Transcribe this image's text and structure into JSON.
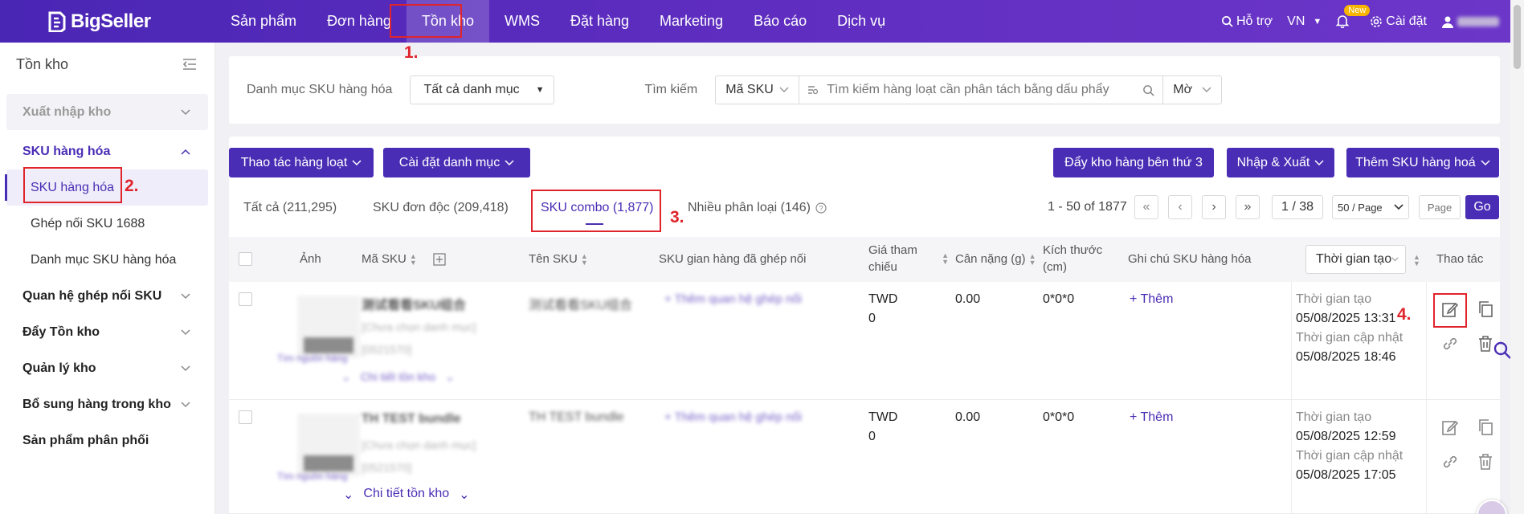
{
  "topnav": {
    "brand": "BigSeller",
    "menu": [
      "Sản phẩm",
      "Đơn hàng",
      "Tồn kho",
      "WMS",
      "Đặt hàng",
      "Marketing",
      "Báo cáo",
      "Dịch vụ"
    ],
    "help": "Hỗ trợ",
    "lang": "VN",
    "new_badge": "New",
    "settings": "Cài đặt"
  },
  "sidebar": {
    "title": "Tồn kho",
    "groups": {
      "g1": "Xuất nhập kho",
      "g2": "SKU hàng hóa",
      "sub1": "SKU hàng hóa",
      "sub2": "Ghép nối SKU 1688",
      "sub3": "Danh mục SKU hàng hóa",
      "g3": "Quan hệ ghép nối SKU",
      "g4": "Đẩy Tồn kho",
      "g5": "Quản lý kho",
      "g6": "Bổ sung hàng trong kho",
      "g7": "Sản phẩm phân phối"
    }
  },
  "filter": {
    "category_label": "Danh mục SKU hàng hóa",
    "category_value": "Tất cả danh mục",
    "search_label": "Tìm kiếm",
    "search_field": "Mã SKU",
    "search_placeholder": "Tìm kiếm hàng loạt cần phân tách bằng dấu phẩy",
    "match_mode": "Mờ"
  },
  "toolbar": {
    "bulk": "Thao tác hàng loạt",
    "category_settings": "Cài đặt danh mục",
    "push_3pl": "Đẩy kho hàng bên thứ 3",
    "import_export": "Nhập & Xuất",
    "add_sku": "Thêm SKU hàng hoá"
  },
  "tabs": [
    "Tất cả (211,295)",
    "SKU đơn độc (209,418)",
    "SKU combo (1,877)",
    "Nhiều phân loại (146)"
  ],
  "pagination": {
    "range": "1 - 50 of 1877",
    "page": "1 / 38",
    "per_page": "50 / Page",
    "page_placeholder": "Page",
    "go": "Go"
  },
  "table": {
    "headers": {
      "image": "Ảnh",
      "sku": "Mã SKU",
      "name": "Tên SKU",
      "linked": "SKU gian hàng đã ghép nối",
      "price_1": "Giá tham",
      "price_2": "chiếu",
      "weight": "Cân nặng (g)",
      "size_1": "Kích thước",
      "size_2": "(cm)",
      "note": "Ghi chú SKU hàng hóa",
      "time_sort": "Thời gian tạo",
      "actions": "Thao tác"
    },
    "rows": [
      {
        "sku_code": "测试看看SKU组合",
        "category": "[Chưa chọn danh mục]",
        "sku_id": "[0521570]",
        "source_link": "Tìm nguồn hàng",
        "inventory_detail": "Chi tiết tồn kho",
        "name": "测试看看SKU组合",
        "link_action": "+ Thêm quan hệ ghép nối",
        "currency": "TWD",
        "price": "0",
        "weight": "0.00",
        "size": "0*0*0",
        "note_action": "+ Thêm",
        "created_label": "Thời gian tạo",
        "created": "05/08/2025 13:31",
        "updated_label": "Thời gian cập nhật",
        "updated": "05/08/2025 18:46"
      },
      {
        "sku_code": "TH TEST bundle",
        "category": "[Chưa chọn danh mục]",
        "sku_id": "[0521570]",
        "source_link": "Tìm nguồn hàng",
        "inventory_detail": "Chi tiết tồn kho",
        "name": "TH TEST bundle",
        "link_action": "+ Thêm quan hệ ghép nối",
        "currency": "TWD",
        "price": "0",
        "weight": "0.00",
        "size": "0*0*0",
        "note_action": "+ Thêm",
        "created_label": "Thời gian tạo",
        "created": "05/08/2025 12:59",
        "updated_label": "Thời gian cập nhật",
        "updated": "05/08/2025 17:05"
      }
    ]
  },
  "annotations": [
    "1.",
    "2.",
    "3.",
    "4."
  ],
  "colors": {
    "primary": "#4a2db5",
    "highlight": "#e0242b",
    "badge": "#f7b500"
  }
}
